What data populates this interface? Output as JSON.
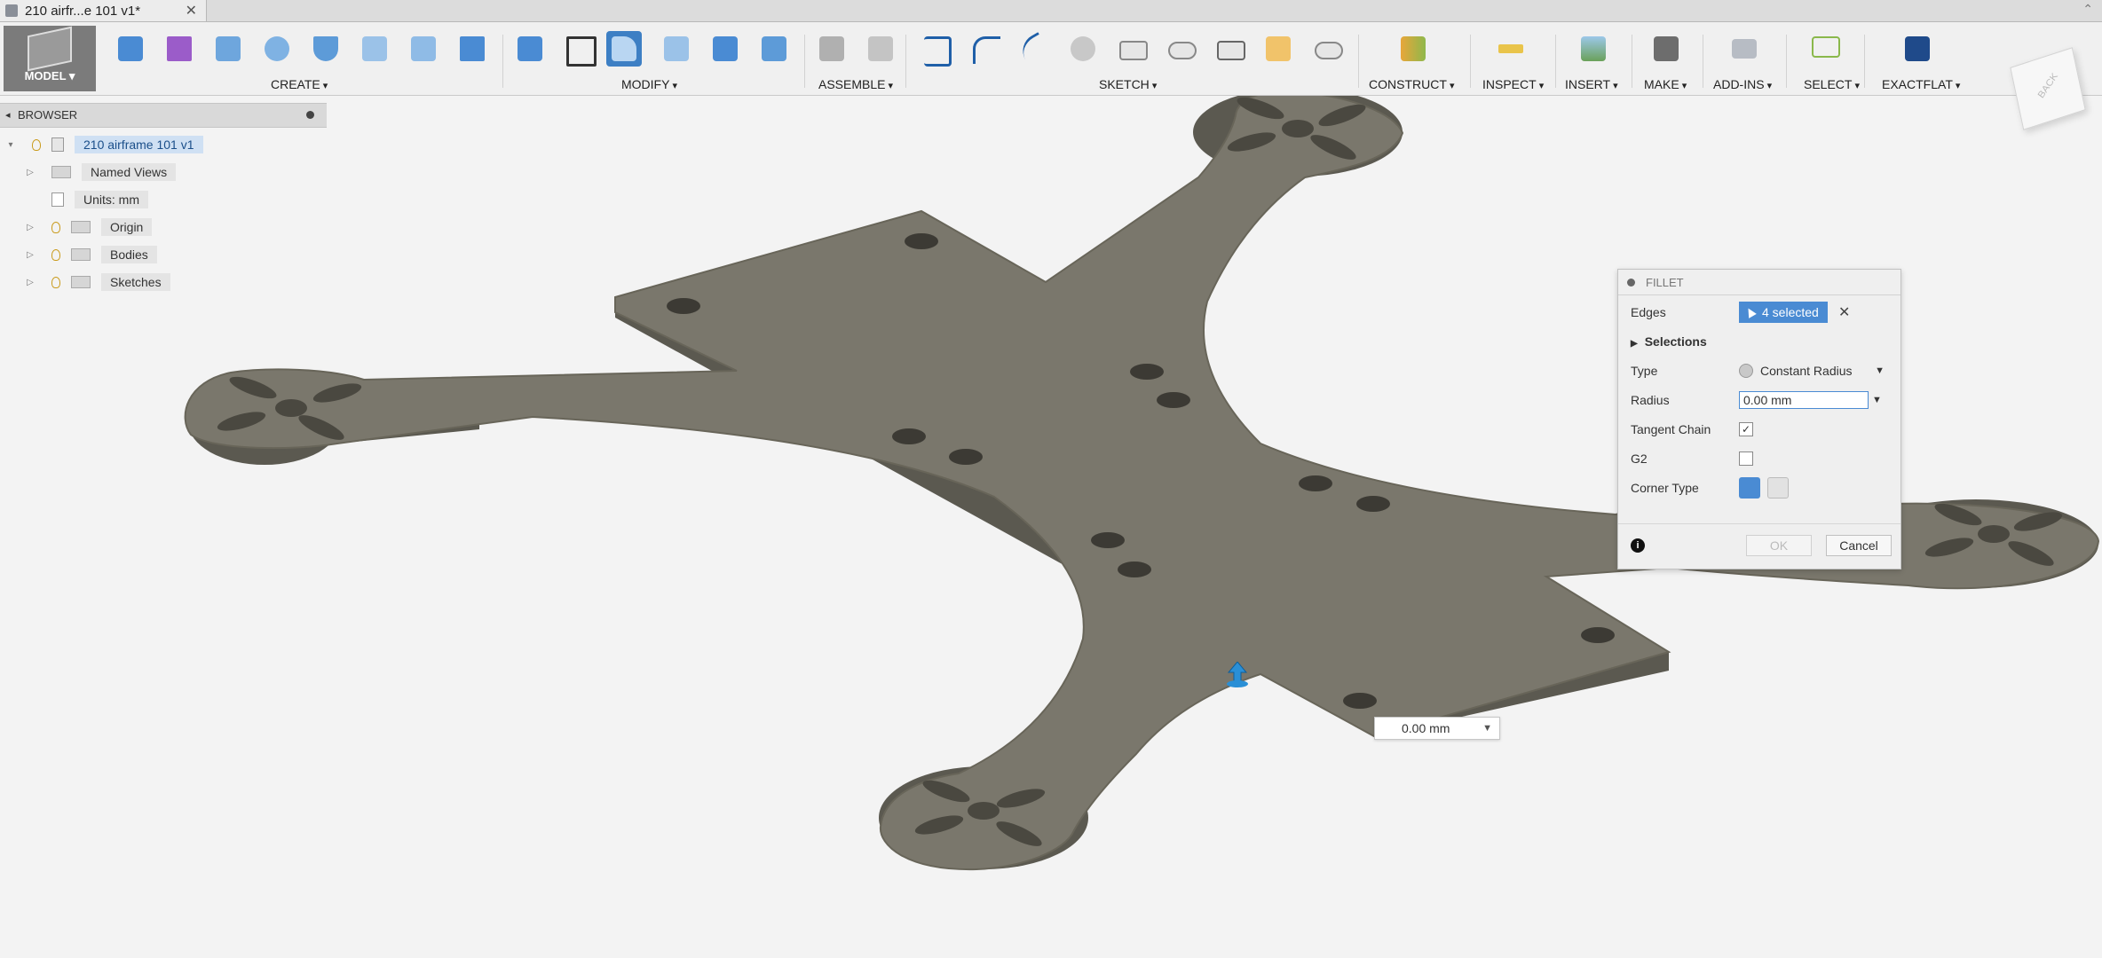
{
  "tab": {
    "title": "210 airfr...e 101 v1*",
    "close": "✕"
  },
  "toolbar": {
    "model_label": "MODEL",
    "groups": {
      "create": "CREATE",
      "modify": "MODIFY",
      "assemble": "ASSEMBLE",
      "sketch": "SKETCH",
      "construct": "CONSTRUCT",
      "inspect": "INSPECT",
      "insert": "INSERT",
      "make": "MAKE",
      "addins": "ADD-INS",
      "select": "SELECT",
      "exactflat": "EXACTFLAT"
    }
  },
  "viewcube": {
    "face_label": "BACK"
  },
  "browser": {
    "title": "BROWSER",
    "root": "210 airframe 101 v1",
    "items": [
      {
        "label": "Named Views"
      },
      {
        "label": "Units: mm"
      },
      {
        "label": "Origin"
      },
      {
        "label": "Bodies"
      },
      {
        "label": "Sketches"
      }
    ]
  },
  "fillet": {
    "title": "FILLET",
    "edges_label": "Edges",
    "edges_value": "4 selected",
    "selections_label": "Selections",
    "type_label": "Type",
    "type_value": "Constant Radius",
    "radius_label": "Radius",
    "radius_value": "0.00 mm",
    "tangent_label": "Tangent Chain",
    "tangent_checked": true,
    "g2_label": "G2",
    "g2_checked": false,
    "corner_label": "Corner Type",
    "ok": "OK",
    "cancel": "Cancel"
  },
  "canvas_value": "0.00 mm",
  "colors": {
    "accent": "#4a8bd3",
    "body": "#7a776c",
    "body_side": "#5b5950",
    "background": "#f3f3f3"
  }
}
